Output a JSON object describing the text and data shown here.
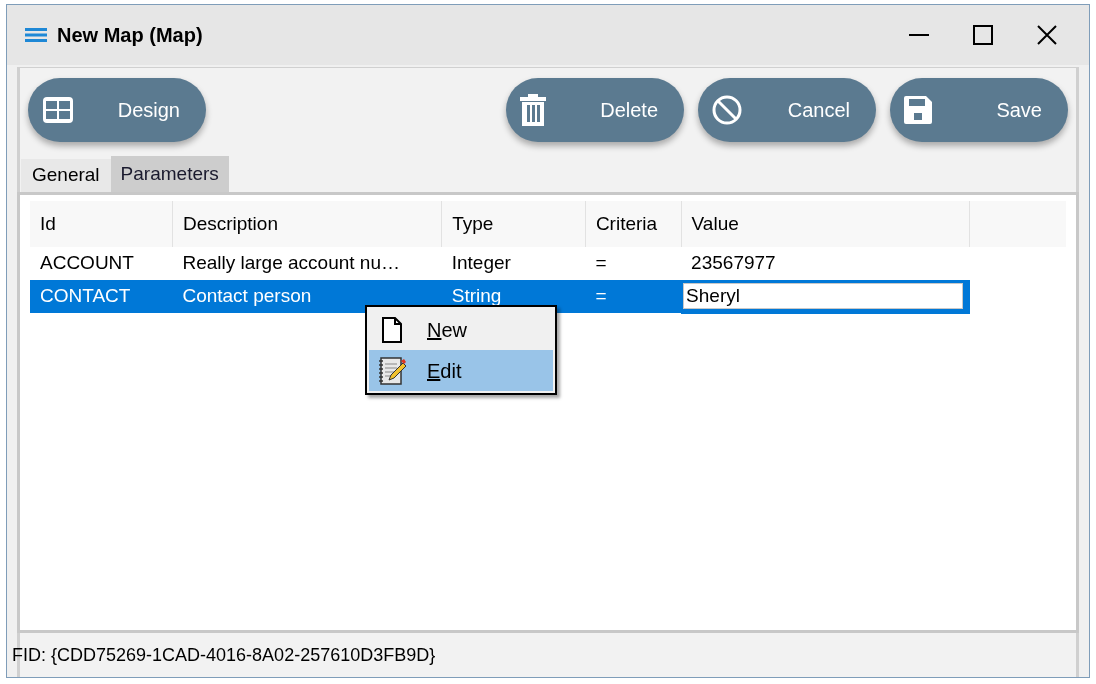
{
  "window": {
    "title": "New Map (Map)"
  },
  "toolbar": {
    "left": [
      {
        "label": "Design",
        "kind": "grid"
      }
    ],
    "right": [
      {
        "label": "Delete",
        "kind": "trash"
      },
      {
        "label": "Cancel",
        "kind": "cancel"
      },
      {
        "label": "Save",
        "kind": "disk"
      }
    ]
  },
  "tabs": [
    {
      "label": "General",
      "selected": false
    },
    {
      "label": "Parameters",
      "selected": true
    }
  ],
  "table": {
    "columns": [
      "Id",
      "Description",
      "Type",
      "Criteria",
      "Value"
    ],
    "rows": [
      {
        "cells": [
          "ACCOUNT",
          "Really large account nu…",
          "Integer",
          "=",
          "23567977"
        ],
        "selected": false,
        "editing": false
      },
      {
        "cells": [
          "CONTACT",
          "Contact person",
          "String",
          "=",
          "Sheryl"
        ],
        "selected": true,
        "editing": true
      }
    ]
  },
  "context_menu": [
    {
      "label": "New",
      "kind": "page",
      "selected": false,
      "shortcut_underlined": true
    },
    {
      "label": "Edit",
      "kind": "notepad",
      "selected": true,
      "shortcut_underlined": true
    }
  ],
  "status_bar": "FID: {CDD75269-1CAD-4016-8A02-257610D3FB9D}"
}
